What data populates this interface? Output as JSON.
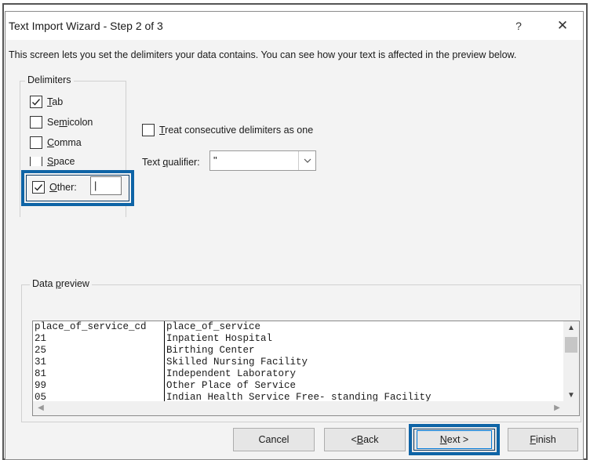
{
  "window": {
    "title": "Text Import Wizard - Step 2 of 3",
    "help_glyph": "?",
    "close_glyph": "✕"
  },
  "instructions": "This screen lets you set the delimiters your data contains.  You can see how your text is affected in the preview below.",
  "delimiters": {
    "title": "Delimiters",
    "tab": {
      "label_u": "T",
      "label_rest": "ab",
      "checked": true
    },
    "semicolon": {
      "label_pre": "Se",
      "label_u": "m",
      "label_rest": "icolon",
      "checked": false
    },
    "comma": {
      "label_u": "C",
      "label_rest": "omma",
      "checked": false
    },
    "space": {
      "label_u": "S",
      "label_rest": "pace",
      "checked": false
    },
    "other": {
      "label_u": "O",
      "label_rest": "ther:",
      "checked": true,
      "value": "|"
    }
  },
  "consecutive": {
    "label_u": "T",
    "label_rest": "reat consecutive delimiters as one",
    "checked": false
  },
  "qualifier": {
    "label_pre": "Text ",
    "label_u": "q",
    "label_rest": "ualifier:",
    "value": "\""
  },
  "preview": {
    "title_pre": "Data ",
    "title_u": "p",
    "title_rest": "review",
    "rows": [
      [
        "place_of_service_cd",
        "place_of_service"
      ],
      [
        "21",
        "Inpatient Hospital"
      ],
      [
        "25",
        "Birthing Center"
      ],
      [
        "31",
        "Skilled Nursing Facility"
      ],
      [
        "81",
        "Independent Laboratory"
      ],
      [
        "99",
        "Other Place of Service"
      ],
      [
        "05",
        "Indian Health Service Free- standing Facility"
      ]
    ]
  },
  "buttons": {
    "cancel": "Cancel",
    "back_pre": "< ",
    "back_u": "B",
    "back_rest": "ack",
    "next_u": "N",
    "next_rest": "ext >",
    "finish_u": "F",
    "finish_rest": "inish"
  },
  "colors": {
    "highlight": "#0e64a6",
    "dialog_bg": "#f3f3f3"
  }
}
